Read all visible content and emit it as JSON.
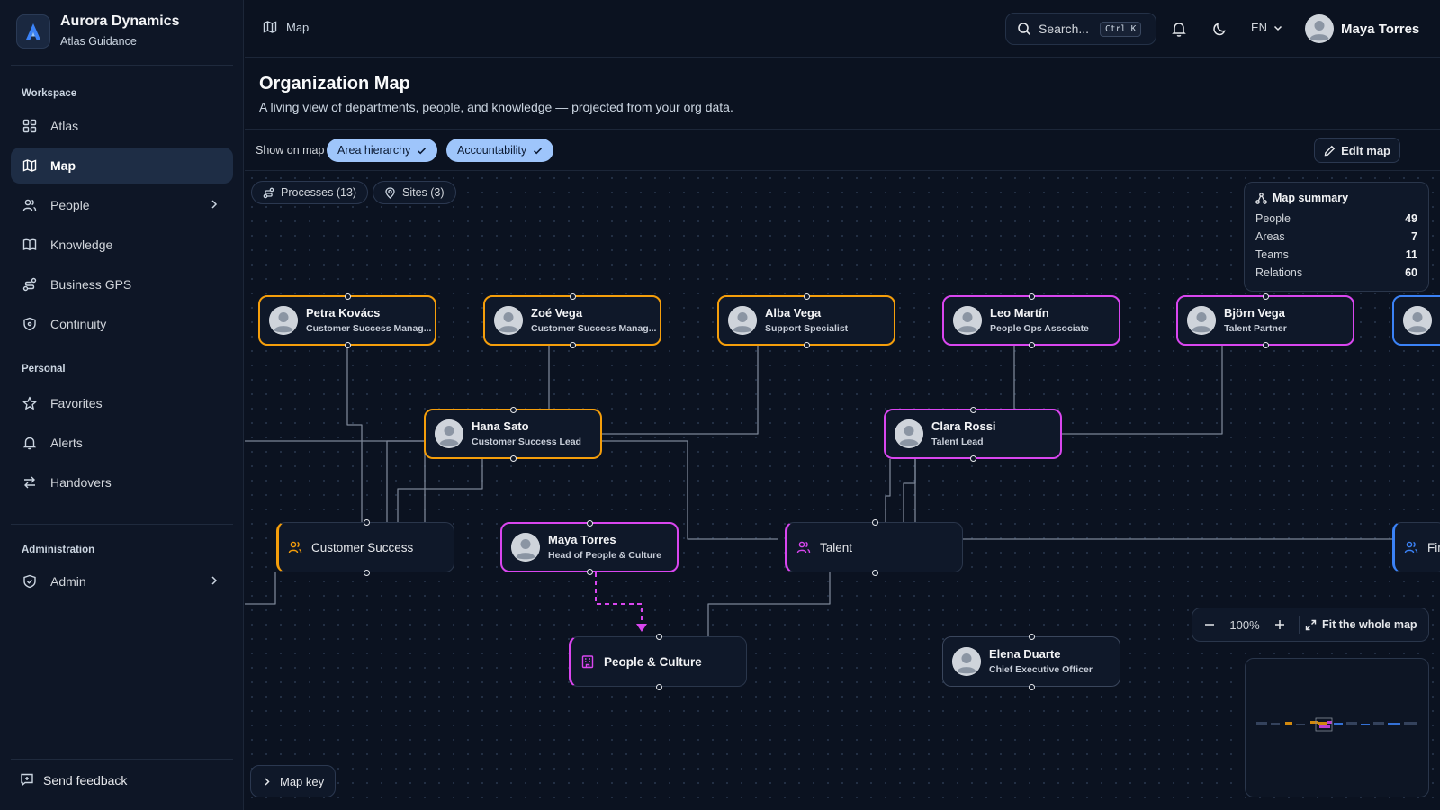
{
  "brand": {
    "name": "Aurora Dynamics",
    "subtitle": "Atlas Guidance"
  },
  "sidebar": {
    "sections": [
      {
        "label": "Workspace"
      },
      {
        "label": "Personal"
      },
      {
        "label": "Administration"
      }
    ],
    "items": [
      {
        "label": "Atlas",
        "icon": "grid-icon"
      },
      {
        "label": "Map",
        "icon": "map-icon",
        "active": true
      },
      {
        "label": "People",
        "icon": "users-icon",
        "has_children": true
      },
      {
        "label": "Knowledge",
        "icon": "book-icon"
      },
      {
        "label": "Business GPS",
        "icon": "route-icon"
      },
      {
        "label": "Continuity",
        "icon": "shield-icon"
      },
      {
        "label": "Favorites",
        "icon": "star-icon"
      },
      {
        "label": "Alerts",
        "icon": "bell-icon"
      },
      {
        "label": "Handovers",
        "icon": "swap-icon"
      },
      {
        "label": "Admin",
        "icon": "shield-check-icon",
        "has_children": true
      }
    ],
    "feedback": "Send feedback"
  },
  "topbar": {
    "breadcrumb": "Map",
    "search_placeholder": "Search...",
    "search_shortcut": "Ctrl K",
    "language": "EN",
    "user_name": "Maya Torres"
  },
  "page": {
    "title": "Organization Map",
    "subtitle": "A living view of departments, people, and knowledge — projected from your org data."
  },
  "filters": {
    "show_label": "Show on map",
    "chips": [
      "Area hierarchy",
      "Accountability"
    ],
    "edit_label": "Edit map"
  },
  "canvas": {
    "pills": [
      "Processes (13)",
      "Sites (3)"
    ],
    "colors": {
      "customer_success": "#f59e0b",
      "people_culture": "#d946ef",
      "other": "#3b82f6",
      "neutral": "#3a465c"
    },
    "people": [
      {
        "name": "Petra Kovács",
        "role": "Customer Success Manag..."
      },
      {
        "name": "Zoé Vega",
        "role": "Customer Success Manag..."
      },
      {
        "name": "Alba Vega",
        "role": "Support Specialist"
      },
      {
        "name": "Leo Martín",
        "role": "People Ops Associate"
      },
      {
        "name": "Björn Vega",
        "role": "Talent Partner"
      },
      {
        "name": "Hana Sato",
        "role": "Customer Success Lead"
      },
      {
        "name": "Clara Rossi",
        "role": "Talent Lead"
      },
      {
        "name": "Maya Torres",
        "role": "Head of People & Culture"
      },
      {
        "name": "Elena Duarte",
        "role": "Chief Executive Officer"
      }
    ],
    "teams": [
      {
        "name": "Customer Success"
      },
      {
        "name": "Talent"
      },
      {
        "name": "Firm"
      }
    ],
    "department": {
      "name": "People & Culture"
    },
    "summary": {
      "title": "Map summary",
      "rows": [
        {
          "label": "People",
          "value": "49"
        },
        {
          "label": "Areas",
          "value": "7"
        },
        {
          "label": "Teams",
          "value": "11"
        },
        {
          "label": "Relations",
          "value": "60"
        }
      ]
    },
    "zoom": {
      "level": "100%",
      "fit_label": "Fit the whole map"
    },
    "map_key": "Map key"
  }
}
